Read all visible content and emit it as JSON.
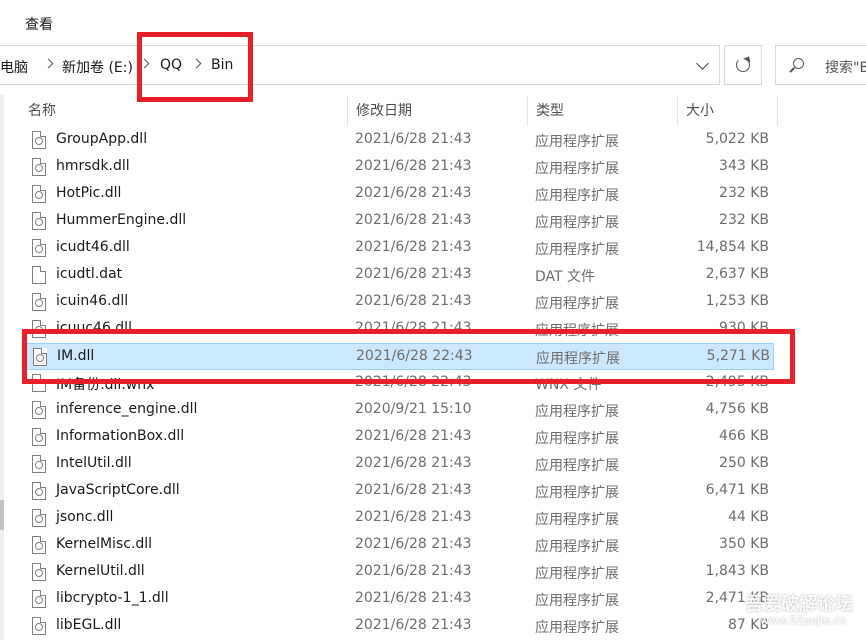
{
  "ribbon": {
    "view_tab": "查看"
  },
  "address": {
    "crumbs": [
      "此电脑",
      "新加卷 (E:)",
      "QQ",
      "Bin"
    ]
  },
  "search": {
    "placeholder": "搜索\"Bin\""
  },
  "columns": {
    "name": "名称",
    "date": "修改日期",
    "type": "类型",
    "size": "大小"
  },
  "files": [
    {
      "name": "GroupApp.dll",
      "date": "2021/6/28 21:43",
      "type": "应用程序扩展",
      "size": "5,022 KB",
      "icon": "dll-file-icon"
    },
    {
      "name": "hmrsdk.dll",
      "date": "2021/6/28 21:43",
      "type": "应用程序扩展",
      "size": "343 KB",
      "icon": "dll-file-icon"
    },
    {
      "name": "HotPic.dll",
      "date": "2021/6/28 21:43",
      "type": "应用程序扩展",
      "size": "232 KB",
      "icon": "dll-file-icon"
    },
    {
      "name": "HummerEngine.dll",
      "date": "2021/6/28 21:43",
      "type": "应用程序扩展",
      "size": "232 KB",
      "icon": "dll-file-icon"
    },
    {
      "name": "icudt46.dll",
      "date": "2021/6/28 21:43",
      "type": "应用程序扩展",
      "size": "14,854 KB",
      "icon": "dll-file-icon"
    },
    {
      "name": "icudtl.dat",
      "date": "2021/6/28 21:43",
      "type": "DAT 文件",
      "size": "2,637 KB",
      "icon": "blank-file-icon"
    },
    {
      "name": "icuin46.dll",
      "date": "2021/6/28 21:43",
      "type": "应用程序扩展",
      "size": "1,253 KB",
      "icon": "dll-file-icon"
    },
    {
      "name": "icuuc46.dll",
      "date": "2021/6/28 21:43",
      "type": "应用程序扩展",
      "size": "930 KB",
      "icon": "dll-file-icon"
    },
    {
      "name": "IM.dll",
      "date": "2021/6/28 22:43",
      "type": "应用程序扩展",
      "size": "5,271 KB",
      "icon": "dll-file-icon",
      "selected": true
    },
    {
      "name": "IM备份.dll.wnx",
      "date": "2021/6/28 22:43",
      "type": "WNX 文件",
      "size": "2,495 KB",
      "icon": "blank-file-icon"
    },
    {
      "name": "inference_engine.dll",
      "date": "2020/9/21 15:10",
      "type": "应用程序扩展",
      "size": "4,756 KB",
      "icon": "dll-file-icon"
    },
    {
      "name": "InformationBox.dll",
      "date": "2021/6/28 21:43",
      "type": "应用程序扩展",
      "size": "466 KB",
      "icon": "dll-file-icon"
    },
    {
      "name": "IntelUtil.dll",
      "date": "2021/6/28 21:43",
      "type": "应用程序扩展",
      "size": "250 KB",
      "icon": "dll-file-icon"
    },
    {
      "name": "JavaScriptCore.dll",
      "date": "2021/6/28 21:43",
      "type": "应用程序扩展",
      "size": "6,471 KB",
      "icon": "dll-file-icon"
    },
    {
      "name": "jsonc.dll",
      "date": "2021/6/28 21:43",
      "type": "应用程序扩展",
      "size": "44 KB",
      "icon": "dll-file-icon"
    },
    {
      "name": "KernelMisc.dll",
      "date": "2021/6/28 21:43",
      "type": "应用程序扩展",
      "size": "350 KB",
      "icon": "dll-file-icon"
    },
    {
      "name": "KernelUtil.dll",
      "date": "2021/6/28 21:43",
      "type": "应用程序扩展",
      "size": "1,843 KB",
      "icon": "dll-file-icon"
    },
    {
      "name": "libcrypto-1_1.dll",
      "date": "2021/6/28 21:43",
      "type": "应用程序扩展",
      "size": "2,471 KB",
      "icon": "dll-file-icon"
    },
    {
      "name": "libEGL.dll",
      "date": "2021/6/28 21:43",
      "type": "应用程序扩展",
      "size": "87 KB",
      "icon": "dll-file-icon"
    }
  ],
  "watermark": {
    "text": "吾爱破解论坛",
    "url": "www.52pojie.cn"
  },
  "colors": {
    "selection": "#cce8ff",
    "selection_border": "#99d1ff",
    "annotation_red": "#e8202a"
  }
}
